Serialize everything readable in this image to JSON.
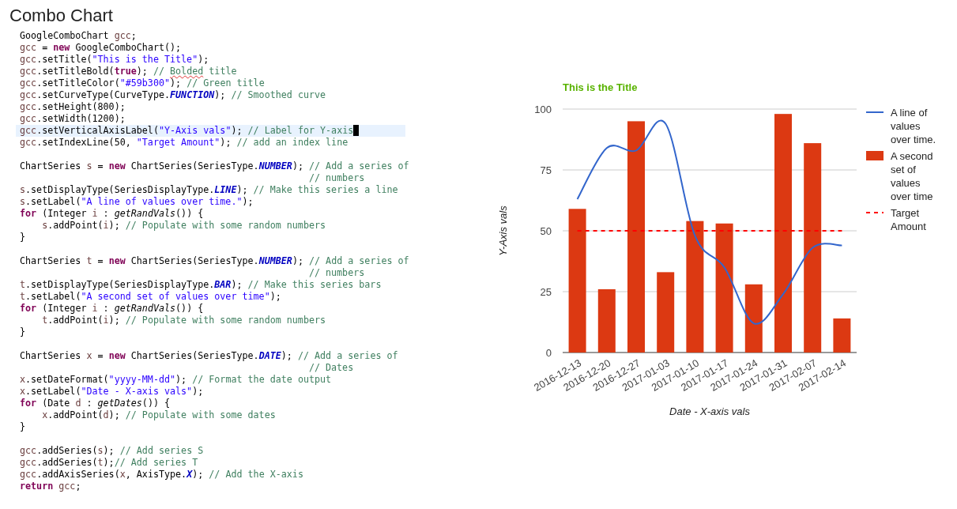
{
  "page": {
    "title": "Combo Chart"
  },
  "code": {
    "lines": [
      {
        "kind": "code",
        "current": false,
        "tokens": [
          {
            "kind": "plain",
            "text": "GoogleComboChart "
          },
          {
            "kind": "var",
            "text": "gcc"
          },
          {
            "kind": "plain",
            "text": ";"
          }
        ]
      },
      {
        "kind": "code",
        "current": false,
        "tokens": [
          {
            "kind": "var",
            "text": "gcc"
          },
          {
            "kind": "plain",
            "text": " = "
          },
          {
            "kind": "keyword",
            "text": "new"
          },
          {
            "kind": "plain",
            "text": " GoogleComboChart();"
          }
        ]
      },
      {
        "kind": "code",
        "current": false,
        "tokens": [
          {
            "kind": "var",
            "text": "gcc"
          },
          {
            "kind": "plain",
            "text": ".setTitle("
          },
          {
            "kind": "string",
            "text": "\"This is the Title\""
          },
          {
            "kind": "plain",
            "text": ");"
          }
        ]
      },
      {
        "kind": "code",
        "current": false,
        "tokens": [
          {
            "kind": "var",
            "text": "gcc"
          },
          {
            "kind": "plain",
            "text": ".setTitleBold("
          },
          {
            "kind": "keyword",
            "text": "true"
          },
          {
            "kind": "plain",
            "text": "); "
          },
          {
            "kind": "comment",
            "text": "// "
          },
          {
            "kind": "typo",
            "text": "Bolded"
          },
          {
            "kind": "comment",
            "text": " title"
          }
        ]
      },
      {
        "kind": "code",
        "current": false,
        "tokens": [
          {
            "kind": "var",
            "text": "gcc"
          },
          {
            "kind": "plain",
            "text": ".setTitleColor("
          },
          {
            "kind": "string",
            "text": "\"#59b300\""
          },
          {
            "kind": "plain",
            "text": "); "
          },
          {
            "kind": "comment",
            "text": "// Green title"
          }
        ]
      },
      {
        "kind": "code",
        "current": false,
        "tokens": [
          {
            "kind": "var",
            "text": "gcc"
          },
          {
            "kind": "plain",
            "text": ".setCurveType(CurveType."
          },
          {
            "kind": "constant",
            "text": "FUNCTION"
          },
          {
            "kind": "plain",
            "text": "); "
          },
          {
            "kind": "comment",
            "text": "// Smoothed curve"
          }
        ]
      },
      {
        "kind": "code",
        "current": false,
        "tokens": [
          {
            "kind": "var",
            "text": "gcc"
          },
          {
            "kind": "plain",
            "text": ".setHeight(800);"
          }
        ]
      },
      {
        "kind": "code",
        "current": false,
        "tokens": [
          {
            "kind": "var",
            "text": "gcc"
          },
          {
            "kind": "plain",
            "text": ".setWidth(1200);"
          }
        ]
      },
      {
        "kind": "code",
        "current": true,
        "tokens": [
          {
            "kind": "var",
            "text": "gcc"
          },
          {
            "kind": "plain",
            "text": ".setVerticalAxisLabel("
          },
          {
            "kind": "string",
            "text": "\"Y-Axis vals\""
          },
          {
            "kind": "plain",
            "text": "); "
          },
          {
            "kind": "comment",
            "text": "// Label for Y-axis"
          }
        ]
      },
      {
        "kind": "code",
        "current": false,
        "tokens": [
          {
            "kind": "var",
            "text": "gcc"
          },
          {
            "kind": "plain",
            "text": ".setIndexLine(50, "
          },
          {
            "kind": "string",
            "text": "\"Target Amount\""
          },
          {
            "kind": "plain",
            "text": "); "
          },
          {
            "kind": "comment",
            "text": "// add an index line"
          }
        ]
      },
      {
        "kind": "blank",
        "current": false
      },
      {
        "kind": "code",
        "current": false,
        "tokens": [
          {
            "kind": "plain",
            "text": "ChartSeries "
          },
          {
            "kind": "var",
            "text": "s"
          },
          {
            "kind": "plain",
            "text": " = "
          },
          {
            "kind": "keyword",
            "text": "new"
          },
          {
            "kind": "plain",
            "text": " ChartSeries(SeriesType."
          },
          {
            "kind": "constant",
            "text": "NUMBER"
          },
          {
            "kind": "plain",
            "text": "); "
          },
          {
            "kind": "comment",
            "text": "// Add a series of"
          }
        ]
      },
      {
        "kind": "continuation",
        "current": false,
        "tokens": [
          {
            "kind": "comment",
            "text": "// numbers"
          }
        ]
      },
      {
        "kind": "code",
        "current": false,
        "tokens": [
          {
            "kind": "var",
            "text": "s"
          },
          {
            "kind": "plain",
            "text": ".setDisplayType(SeriesDisplayType."
          },
          {
            "kind": "constant",
            "text": "LINE"
          },
          {
            "kind": "plain",
            "text": "); "
          },
          {
            "kind": "comment",
            "text": "// Make this series a line"
          }
        ]
      },
      {
        "kind": "code",
        "current": false,
        "tokens": [
          {
            "kind": "var",
            "text": "s"
          },
          {
            "kind": "plain",
            "text": ".setLabel("
          },
          {
            "kind": "string",
            "text": "\"A line of values over time.\""
          },
          {
            "kind": "plain",
            "text": ");"
          }
        ]
      },
      {
        "kind": "code",
        "current": false,
        "tokens": [
          {
            "kind": "keyword",
            "text": "for"
          },
          {
            "kind": "plain",
            "text": " (Integer "
          },
          {
            "kind": "var",
            "text": "i"
          },
          {
            "kind": "plain",
            "text": " : "
          },
          {
            "kind": "static",
            "text": "getRandVals"
          },
          {
            "kind": "plain",
            "text": "()) {"
          }
        ]
      },
      {
        "kind": "nested",
        "current": false,
        "tokens": [
          {
            "kind": "var",
            "text": "s"
          },
          {
            "kind": "plain",
            "text": ".addPoint("
          },
          {
            "kind": "var",
            "text": "i"
          },
          {
            "kind": "plain",
            "text": "); "
          },
          {
            "kind": "comment",
            "text": "// Populate with some random numbers"
          }
        ]
      },
      {
        "kind": "code",
        "current": false,
        "tokens": [
          {
            "kind": "plain",
            "text": "}"
          }
        ]
      },
      {
        "kind": "blank",
        "current": false
      },
      {
        "kind": "code",
        "current": false,
        "tokens": [
          {
            "kind": "plain",
            "text": "ChartSeries "
          },
          {
            "kind": "var",
            "text": "t"
          },
          {
            "kind": "plain",
            "text": " = "
          },
          {
            "kind": "keyword",
            "text": "new"
          },
          {
            "kind": "plain",
            "text": " ChartSeries(SeriesType."
          },
          {
            "kind": "constant",
            "text": "NUMBER"
          },
          {
            "kind": "plain",
            "text": "); "
          },
          {
            "kind": "comment",
            "text": "// Add a series of"
          }
        ]
      },
      {
        "kind": "continuation",
        "current": false,
        "tokens": [
          {
            "kind": "comment",
            "text": "// numbers"
          }
        ]
      },
      {
        "kind": "code",
        "current": false,
        "tokens": [
          {
            "kind": "var",
            "text": "t"
          },
          {
            "kind": "plain",
            "text": ".setDisplayType(SeriesDisplayType."
          },
          {
            "kind": "constant",
            "text": "BAR"
          },
          {
            "kind": "plain",
            "text": "); "
          },
          {
            "kind": "comment",
            "text": "// Make this series bars"
          }
        ]
      },
      {
        "kind": "code",
        "current": false,
        "tokens": [
          {
            "kind": "var",
            "text": "t"
          },
          {
            "kind": "plain",
            "text": ".setLabel("
          },
          {
            "kind": "string",
            "text": "\"A second set of values over time\""
          },
          {
            "kind": "plain",
            "text": ");"
          }
        ]
      },
      {
        "kind": "code",
        "current": false,
        "tokens": [
          {
            "kind": "keyword",
            "text": "for"
          },
          {
            "kind": "plain",
            "text": " (Integer "
          },
          {
            "kind": "var",
            "text": "i"
          },
          {
            "kind": "plain",
            "text": " : "
          },
          {
            "kind": "static",
            "text": "getRandVals"
          },
          {
            "kind": "plain",
            "text": "()) {"
          }
        ]
      },
      {
        "kind": "nested",
        "current": false,
        "tokens": [
          {
            "kind": "var",
            "text": "t"
          },
          {
            "kind": "plain",
            "text": ".addPoint("
          },
          {
            "kind": "var",
            "text": "i"
          },
          {
            "kind": "plain",
            "text": "); "
          },
          {
            "kind": "comment",
            "text": "// Populate with some random numbers"
          }
        ]
      },
      {
        "kind": "code",
        "current": false,
        "tokens": [
          {
            "kind": "plain",
            "text": "}"
          }
        ]
      },
      {
        "kind": "blank",
        "current": false
      },
      {
        "kind": "code",
        "current": false,
        "tokens": [
          {
            "kind": "plain",
            "text": "ChartSeries "
          },
          {
            "kind": "var",
            "text": "x"
          },
          {
            "kind": "plain",
            "text": " = "
          },
          {
            "kind": "keyword",
            "text": "new"
          },
          {
            "kind": "plain",
            "text": " ChartSeries(SeriesType."
          },
          {
            "kind": "constant",
            "text": "DATE"
          },
          {
            "kind": "plain",
            "text": "); "
          },
          {
            "kind": "comment",
            "text": "// Add a series of"
          }
        ]
      },
      {
        "kind": "continuation",
        "current": false,
        "tokens": [
          {
            "kind": "comment",
            "text": "// Dates"
          }
        ]
      },
      {
        "kind": "code",
        "current": false,
        "tokens": [
          {
            "kind": "var",
            "text": "x"
          },
          {
            "kind": "plain",
            "text": ".setDateFormat("
          },
          {
            "kind": "string",
            "text": "\"yyyy-MM-dd\""
          },
          {
            "kind": "plain",
            "text": "); "
          },
          {
            "kind": "comment",
            "text": "// Format the date output"
          }
        ]
      },
      {
        "kind": "code",
        "current": false,
        "tokens": [
          {
            "kind": "var",
            "text": "x"
          },
          {
            "kind": "plain",
            "text": ".setLabel("
          },
          {
            "kind": "string",
            "text": "\"Date - X-axis vals\""
          },
          {
            "kind": "plain",
            "text": ");"
          }
        ]
      },
      {
        "kind": "code",
        "current": false,
        "tokens": [
          {
            "kind": "keyword",
            "text": "for"
          },
          {
            "kind": "plain",
            "text": " (Date "
          },
          {
            "kind": "var",
            "text": "d"
          },
          {
            "kind": "plain",
            "text": " : "
          },
          {
            "kind": "static",
            "text": "getDates"
          },
          {
            "kind": "plain",
            "text": "()) {"
          }
        ]
      },
      {
        "kind": "nested",
        "current": false,
        "tokens": [
          {
            "kind": "var",
            "text": "x"
          },
          {
            "kind": "plain",
            "text": ".addPoint("
          },
          {
            "kind": "var",
            "text": "d"
          },
          {
            "kind": "plain",
            "text": "); "
          },
          {
            "kind": "comment",
            "text": "// Populate with some dates"
          }
        ]
      },
      {
        "kind": "code",
        "current": false,
        "tokens": [
          {
            "kind": "plain",
            "text": "}"
          }
        ]
      },
      {
        "kind": "blank",
        "current": false
      },
      {
        "kind": "code",
        "current": false,
        "tokens": [
          {
            "kind": "var",
            "text": "gcc"
          },
          {
            "kind": "plain",
            "text": ".addSeries("
          },
          {
            "kind": "var",
            "text": "s"
          },
          {
            "kind": "plain",
            "text": "); "
          },
          {
            "kind": "comment",
            "text": "// Add series S"
          }
        ]
      },
      {
        "kind": "code",
        "current": false,
        "tokens": [
          {
            "kind": "var",
            "text": "gcc"
          },
          {
            "kind": "plain",
            "text": ".addSeries("
          },
          {
            "kind": "var",
            "text": "t"
          },
          {
            "kind": "plain",
            "text": ");"
          },
          {
            "kind": "comment",
            "text": "// Add series T"
          }
        ]
      },
      {
        "kind": "code",
        "current": false,
        "tokens": [
          {
            "kind": "var",
            "text": "gcc"
          },
          {
            "kind": "plain",
            "text": ".addAxisSeries("
          },
          {
            "kind": "var",
            "text": "x"
          },
          {
            "kind": "plain",
            "text": ", AxisType."
          },
          {
            "kind": "constant",
            "text": "X"
          },
          {
            "kind": "plain",
            "text": "); "
          },
          {
            "kind": "comment",
            "text": "// Add the X-axis"
          }
        ]
      },
      {
        "kind": "code",
        "current": false,
        "tokens": [
          {
            "kind": "keyword",
            "text": "return"
          },
          {
            "kind": "var",
            "text": " gcc"
          },
          {
            "kind": "plain",
            "text": ";"
          }
        ]
      }
    ]
  },
  "chart": {
    "chart_data": {
      "type": "bar",
      "title": "This is the Title",
      "xlabel": "Date - X-axis vals",
      "ylabel": "Y-Axis vals",
      "categories": [
        "2016-12-13",
        "2016-12-20",
        "2016-12-27",
        "2017-01-03",
        "2017-01-10",
        "2017-01-17",
        "2017-01-24",
        "2017-01-31",
        "2017-02-07",
        "2017-02-14"
      ],
      "series": [
        {
          "name": "A line of values over time.",
          "type": "line",
          "color": "#3366cc",
          "values": [
            63,
            84,
            83,
            94,
            48,
            35,
            12,
            24,
            43,
            44
          ]
        },
        {
          "name": "A second set of values over time",
          "color": "#dc3912",
          "values": [
            59,
            26,
            95,
            33,
            54,
            53,
            28,
            98,
            86,
            14
          ]
        },
        {
          "name": "Target Amount",
          "type": "line",
          "line_style": "dashed",
          "color": "#ff0000",
          "values": [
            50,
            50,
            50,
            50,
            50,
            50,
            50,
            50,
            50,
            50
          ]
        }
      ],
      "ylim": [
        0,
        100
      ],
      "yticks": [
        0,
        25,
        50,
        75,
        100
      ],
      "grid": true,
      "legend": "right"
    }
  }
}
